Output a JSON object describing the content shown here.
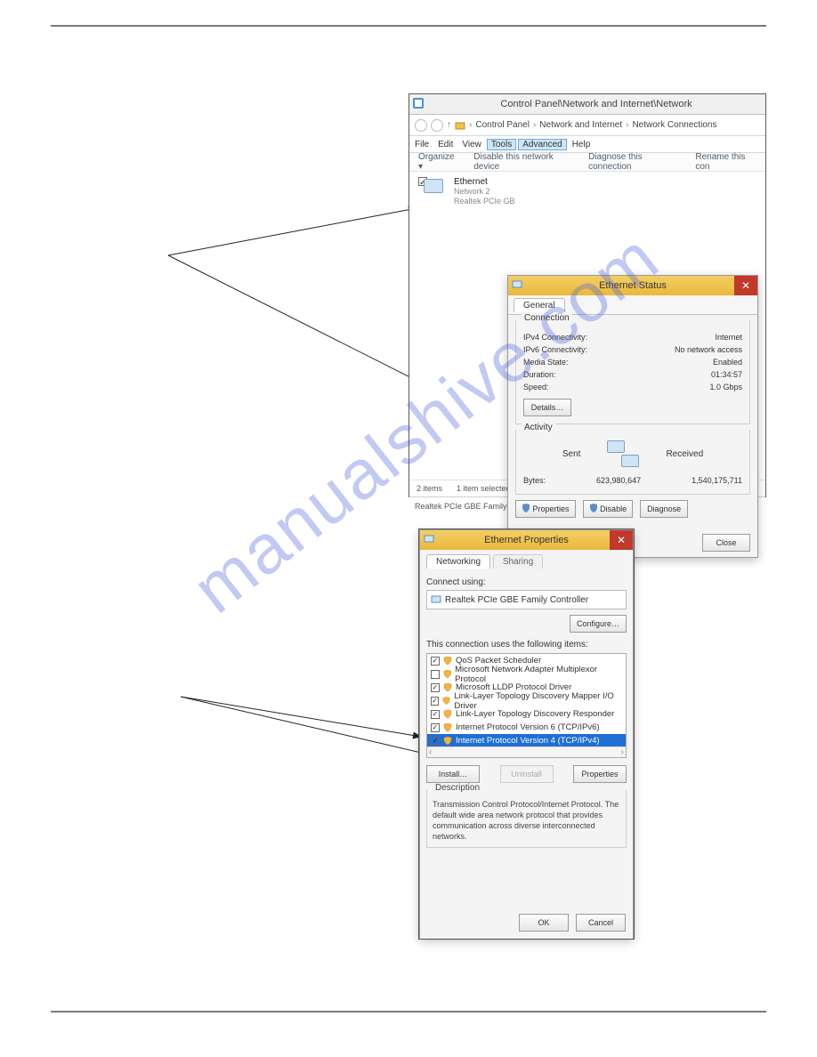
{
  "watermark": "manualshive.com",
  "panelA": {
    "windowTitle": "Control Panel\\Network and Internet\\Network",
    "breadcrumb": [
      "Control Panel",
      "Network and Internet",
      "Network Connections"
    ],
    "menu": [
      "File",
      "Edit",
      "View",
      "Tools",
      "Advanced",
      "Help"
    ],
    "menuSelected": [
      "Tools",
      "Advanced"
    ],
    "toolbar": [
      "Organize ▾",
      "Disable this network device",
      "Diagnose this connection",
      "Rename this con"
    ],
    "ethItem": {
      "title": "Ethernet",
      "sub1": "Network 2",
      "sub2": "Realtek PCIe GB"
    },
    "statusCounts": {
      "items": "2 items",
      "selected": "1 item selected"
    },
    "statusBar": "Realtek PCIe GBE Family Con"
  },
  "statusDlg": {
    "title": "Ethernet Status",
    "tab": "General",
    "connection": {
      "label": "Connection",
      "rows": [
        {
          "k": "IPv4 Connectivity:",
          "v": "Internet"
        },
        {
          "k": "IPv6 Connectivity:",
          "v": "No network access"
        },
        {
          "k": "Media State:",
          "v": "Enabled"
        },
        {
          "k": "Duration:",
          "v": "01:34:57"
        },
        {
          "k": "Speed:",
          "v": "1.0 Gbps"
        }
      ],
      "details": "Details…"
    },
    "activity": {
      "label": "Activity",
      "sent": "Sent",
      "received": "Received",
      "bytesLabel": "Bytes:",
      "sentVal": "623,980,647",
      "recvVal": "1,540,175,711",
      "buttons": [
        "Properties",
        "Disable",
        "Diagnose"
      ]
    },
    "close": "Close"
  },
  "propsDlg": {
    "title": "Ethernet Properties",
    "tabs": [
      "Networking",
      "Sharing"
    ],
    "connectUsing": "Connect using:",
    "device": "Realtek PCIe GBE Family Controller",
    "configure": "Configure…",
    "itemsLabel": "This connection uses the following items:",
    "items": [
      {
        "checked": true,
        "text": "QoS Packet Scheduler"
      },
      {
        "checked": false,
        "text": "Microsoft Network Adapter Multiplexor Protocol"
      },
      {
        "checked": true,
        "text": "Microsoft LLDP Protocol Driver"
      },
      {
        "checked": true,
        "text": "Link-Layer Topology Discovery Mapper I/O Driver"
      },
      {
        "checked": true,
        "text": "Link-Layer Topology Discovery Responder"
      },
      {
        "checked": true,
        "text": "Internet Protocol Version 6 (TCP/IPv6)"
      },
      {
        "checked": true,
        "text": "Internet Protocol Version 4 (TCP/IPv4)",
        "selected": true
      }
    ],
    "buttons": {
      "install": "Install…",
      "uninstall": "Uninstall",
      "properties": "Properties"
    },
    "descLabel": "Description",
    "desc": "Transmission Control Protocol/Internet Protocol. The default wide area network protocol that provides communication across diverse interconnected networks.",
    "ok": "OK",
    "cancel": "Cancel"
  }
}
